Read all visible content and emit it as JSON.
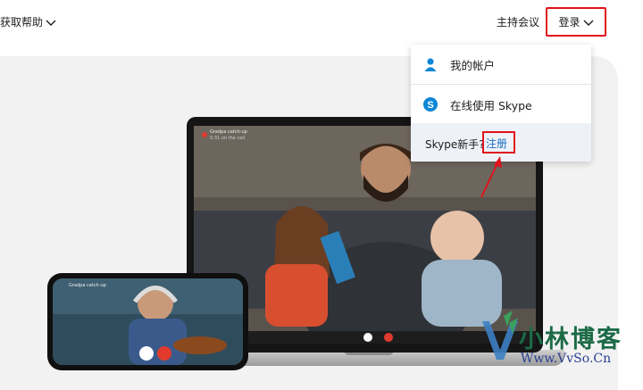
{
  "nav": {
    "help_label": "获取帮助",
    "meeting_label": "主持会议",
    "login_label": "登录"
  },
  "dropdown": {
    "account_label": "我的帐户",
    "online_label": "在线使用 Skype",
    "new_question": "Skype新手?",
    "register_label": "注册"
  },
  "laptop_call": {
    "title": "Gradpa catch-up",
    "subtitle": "0:31 on the call"
  },
  "phone_call": {
    "title": "Gradpa catch-up"
  },
  "watermark": {
    "name": "小林博客",
    "url": "Www.VvSo.Cn"
  },
  "colors": {
    "highlight_red": "#e0131d",
    "link_blue": "#1b6ec2",
    "skype_blue": "#0d86d7",
    "end_call_red": "#e23b2e"
  },
  "icons": {
    "account": "person-icon",
    "online": "skype-logo-icon",
    "login_chevron": "chevron-down-icon"
  }
}
